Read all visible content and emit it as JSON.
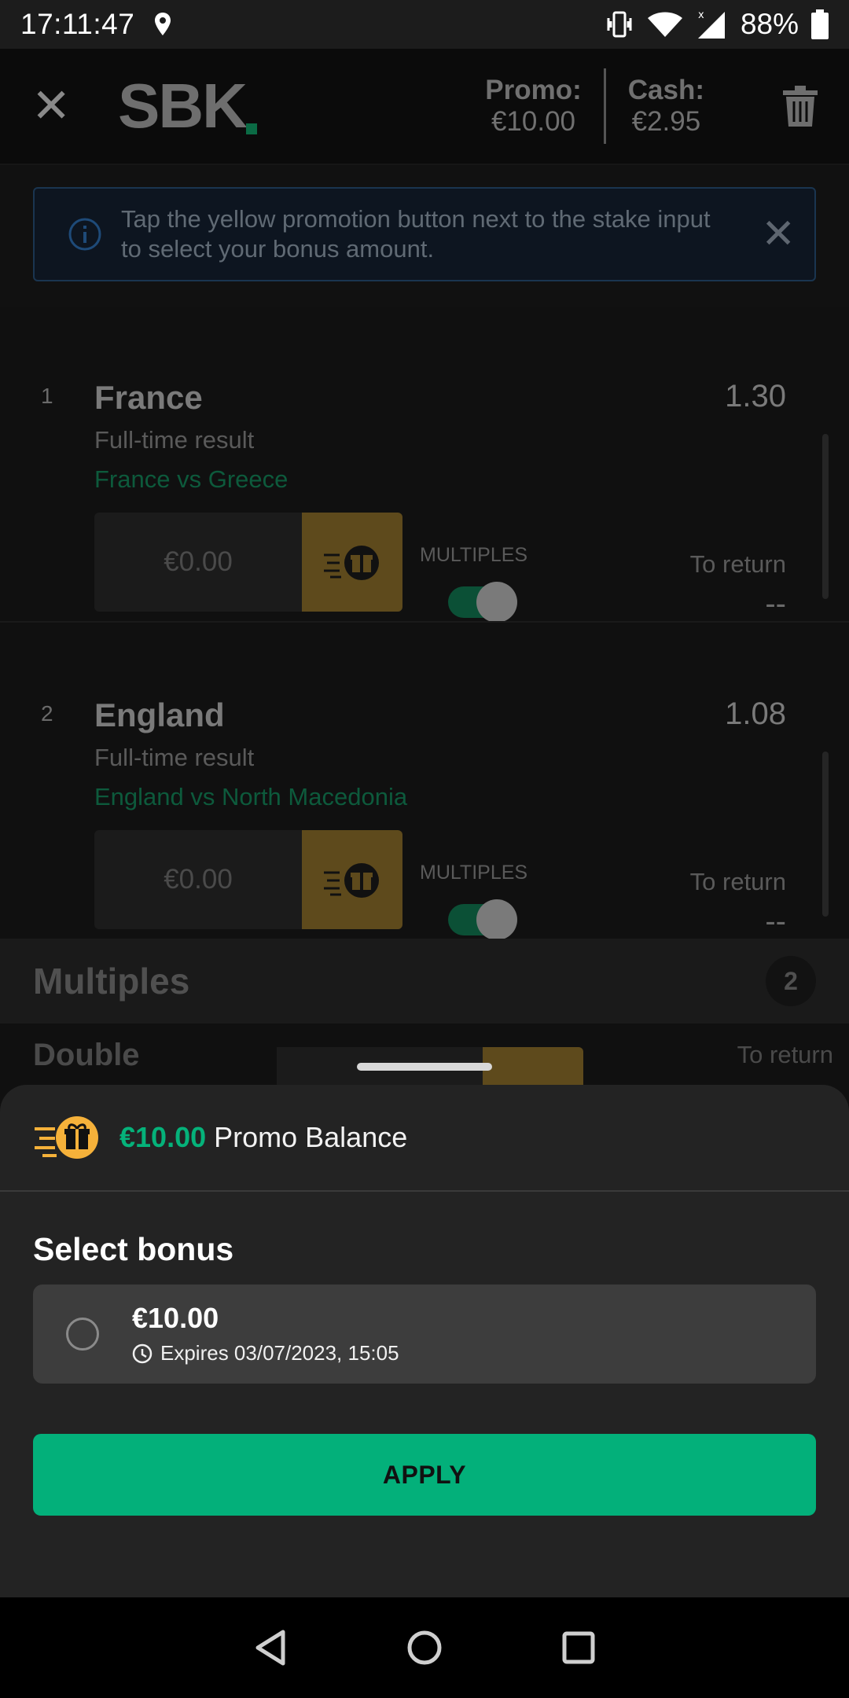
{
  "status_bar": {
    "time": "17:11:47",
    "battery": "88%"
  },
  "header": {
    "logo": "SBK",
    "promo_label": "Promo:",
    "promo_value": "€10.00",
    "cash_label": "Cash:",
    "cash_value": "€2.95"
  },
  "info_banner": {
    "text": "Tap the yellow promotion button next to the stake input to select your bonus amount."
  },
  "selections": [
    {
      "number": "1",
      "team": "France",
      "odds": "1.30",
      "market": "Full-time result",
      "event": "France vs Greece",
      "stake_placeholder": "€0.00",
      "multiples_label": "MULTIPLES",
      "return_label": "To return",
      "return_value": "--"
    },
    {
      "number": "2",
      "team": "England",
      "odds": "1.08",
      "market": "Full-time result",
      "event": "England vs North Macedonia",
      "stake_placeholder": "€0.00",
      "multiples_label": "MULTIPLES",
      "return_label": "To return",
      "return_value": "--"
    }
  ],
  "multiples": {
    "title": "Multiples",
    "count": "2",
    "double_label": "Double",
    "double_return_label": "To return"
  },
  "sheet": {
    "promo_amount": "€10.00",
    "promo_label": "Promo Balance",
    "select_title": "Select bonus",
    "bonus": {
      "amount": "€10.00",
      "expires": "Expires 03/07/2023, 15:05"
    },
    "apply_label": "APPLY"
  },
  "colors": {
    "accent_green": "#03b07a",
    "promo_gold": "#f5b13a"
  }
}
